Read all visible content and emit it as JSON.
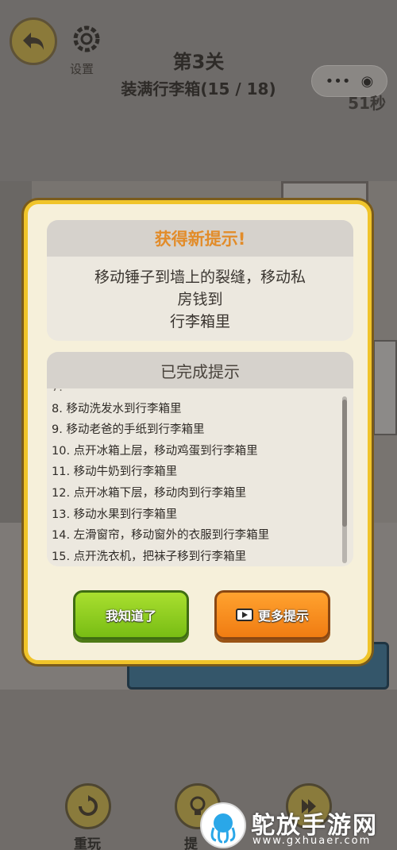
{
  "header": {
    "settings_label": "设置",
    "level_title": "第3关",
    "level_subtitle": "装满行李箱(15 / 18)",
    "capsule_more": "•••",
    "timer": "51秒"
  },
  "modal": {
    "new_hint_title": "获得新提示!",
    "new_hint_lines": [
      "移动锤子到墙上的裂缝，移动私",
      "房钱到",
      "行李箱里"
    ],
    "completed_title": "已完成提示",
    "completed_items": [
      "8.  移动洗发水到行李箱里",
      "9.  移动老爸的手纸到行李箱里",
      "10.  点开冰箱上层，移动鸡蛋到行李箱里",
      "11.  移动牛奶到行李箱里",
      "12.  点开冰箱下层，移动肉到行李箱里",
      "13.  移动水果到行李箱里",
      "14.  左滑窗帘，移动窗外的衣服到行李箱里",
      "15.  点开洗衣机，把袜子移到行李箱里"
    ],
    "ok_button": "我知道了",
    "more_button": "更多提示"
  },
  "bottom": {
    "replay_label": "重玩",
    "hint_label": "提"
  },
  "watermark": {
    "name": "鸵放手游网",
    "url": "www.gxhuaer.com"
  },
  "colors": {
    "modal_border": "#f0c42a",
    "ok_green": "#8fcf22",
    "more_orange": "#f68b1f",
    "hint_title": "#e28c2a"
  }
}
